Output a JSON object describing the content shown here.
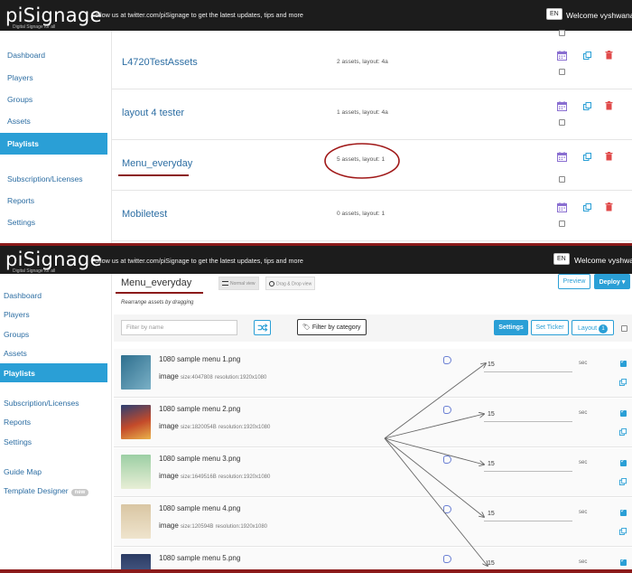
{
  "header": {
    "brand": "piSignage",
    "brand_sub": "Digital Signage for all",
    "tagline": "Follow us at twitter.com/piSignage to get the latest updates, tips and more",
    "lang": "EN",
    "welcome_top": "Welcome vyshwanara",
    "welcome_bottom": "Welcome vyshwa"
  },
  "sidebar": {
    "items": [
      "Dashboard",
      "Players",
      "Groups",
      "Assets",
      "Playlists",
      "Subscription/Licenses",
      "Reports",
      "Settings",
      "Guide Map",
      "Template Designer"
    ],
    "badge_new": "new"
  },
  "playlists": [
    {
      "name": "L4720TestAssets",
      "desc": "2 assets, layout: 4a"
    },
    {
      "name": "layout 4 tester",
      "desc": "1 assets, layout: 4a"
    },
    {
      "name": "Menu_everyday",
      "desc": "5 assets, layout: 1"
    },
    {
      "name": "Mobiletest",
      "desc": "0 assets, layout: 1"
    }
  ],
  "playlist_detail": {
    "title": "Menu_everyday",
    "normal_view": "Normal view",
    "dnd_view": "Drag & Drop view",
    "hint": "Rearrange assets by dragging",
    "preview": "Preview",
    "deploy": "Deploy",
    "filter_placeholder": "Filter by name",
    "by_category": "Filter by category",
    "settings": "Settings",
    "set_ticker": "Set Ticker",
    "layout": "Layout",
    "layout_count": "1"
  },
  "assets": [
    {
      "name": "1080 sample menu 1.png",
      "type": "image",
      "size": "size:4047808",
      "res": "resolution:1920x1080",
      "duration": "15",
      "unit": "sec"
    },
    {
      "name": "1080 sample menu 2.png",
      "type": "image",
      "size": "size:1820054B",
      "res": "resolution:1920x1080",
      "duration": "15",
      "unit": "sec"
    },
    {
      "name": "1080 sample menu 3.png",
      "type": "image",
      "size": "size:1649516B",
      "res": "resolution:1920x1080",
      "duration": "15",
      "unit": "sec"
    },
    {
      "name": "1080 sample menu 4.png",
      "type": "image",
      "size": "size:120594B",
      "res": "resolution:1920x1080",
      "duration": "15",
      "unit": "sec"
    },
    {
      "name": "1080 sample menu 5.png",
      "type": "image",
      "size": "",
      "res": "",
      "duration": "15",
      "unit": "sec"
    }
  ],
  "colors": {
    "accent": "#2a9fd6",
    "annotation": "#8b1a1a",
    "navbar": "#1c1c1c"
  }
}
